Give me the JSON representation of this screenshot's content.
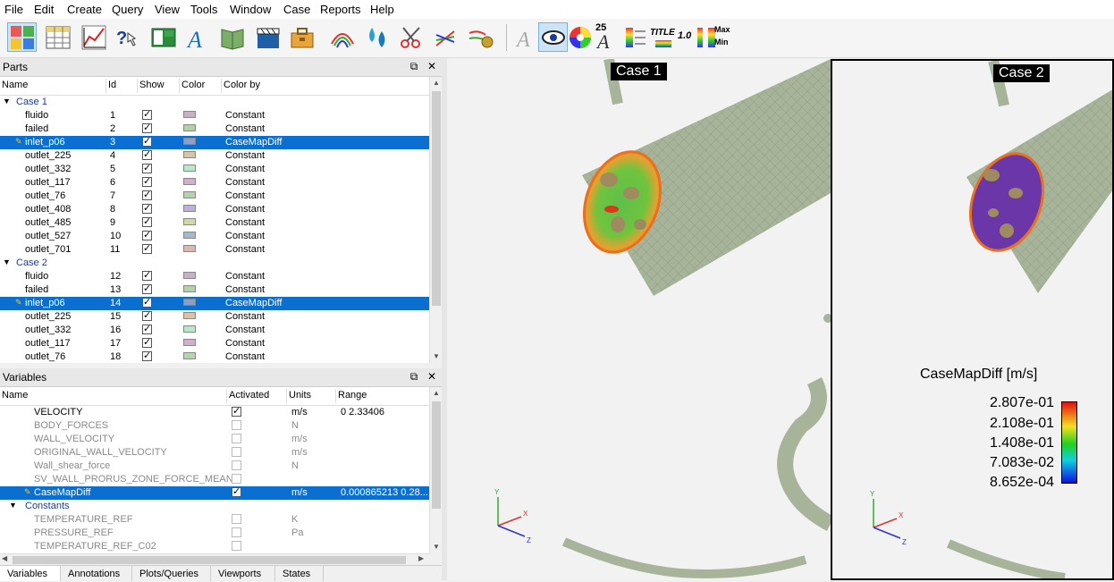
{
  "menu": [
    "File",
    "Edit",
    "Create",
    "Query",
    "View",
    "Tools",
    "Window",
    "Case",
    "Reports",
    "Help"
  ],
  "toolbar": {
    "icons": [
      "parts-icon",
      "table-icon",
      "chart-icon",
      "query-icon",
      "viewport-icon",
      "text-annotation-icon",
      "book-icon",
      "clapper-icon",
      "toolbox-icon",
      "contour-icon",
      "drops-icon",
      "scissors-icon",
      "vector-arrows-icon",
      "particle-trace-icon",
      "annotation-text-icon",
      "eye-icon",
      "color-wheel-icon",
      "font-size-icon",
      "palette-icon",
      "title-icon",
      "palette-rows-icon",
      "number-format-icon",
      "minmax-icon"
    ],
    "font_size_label": "25",
    "title_label": "TITLE",
    "number_label": "1.0",
    "max_label": "Max",
    "min_label": "Min"
  },
  "parts_panel": {
    "title": "Parts",
    "columns": [
      "Name",
      "Id",
      "Show",
      "Color",
      "Color by"
    ],
    "rows": [
      {
        "type": "group",
        "name": "Case 1"
      },
      {
        "name": "fluido",
        "id": "1",
        "show": true,
        "color": "#c9b0c9",
        "colorby": "Constant"
      },
      {
        "name": "failed",
        "id": "2",
        "show": true,
        "color": "#b5cfa8",
        "colorby": "Constant"
      },
      {
        "name": "inlet_p06",
        "id": "3",
        "show": true,
        "color": "#8aa0c8",
        "colorby": "CaseMapDiff",
        "selected": true
      },
      {
        "name": "outlet_225",
        "id": "4",
        "show": true,
        "color": "#d6c4a8",
        "colorby": "Constant"
      },
      {
        "name": "outlet_332",
        "id": "5",
        "show": true,
        "color": "#b8e8c8",
        "colorby": "Constant"
      },
      {
        "name": "outlet_117",
        "id": "6",
        "show": true,
        "color": "#d0b0c8",
        "colorby": "Constant"
      },
      {
        "name": "outlet_76",
        "id": "7",
        "show": true,
        "color": "#b4d4b0",
        "colorby": "Constant"
      },
      {
        "name": "outlet_408",
        "id": "8",
        "show": true,
        "color": "#c0b0d8",
        "colorby": "Constant"
      },
      {
        "name": "outlet_485",
        "id": "9",
        "show": true,
        "color": "#cfd8a8",
        "colorby": "Constant"
      },
      {
        "name": "outlet_527",
        "id": "10",
        "show": true,
        "color": "#a8b8c8",
        "colorby": "Constant"
      },
      {
        "name": "outlet_701",
        "id": "11",
        "show": true,
        "color": "#d8b8b0",
        "colorby": "Constant"
      },
      {
        "type": "group",
        "name": "Case 2"
      },
      {
        "name": "fluido",
        "id": "12",
        "show": true,
        "color": "#c9b0c9",
        "colorby": "Constant"
      },
      {
        "name": "failed",
        "id": "13",
        "show": true,
        "color": "#b5cfa8",
        "colorby": "Constant"
      },
      {
        "name": "inlet_p06",
        "id": "14",
        "show": true,
        "color": "#8aa0c8",
        "colorby": "CaseMapDiff",
        "selected": true
      },
      {
        "name": "outlet_225",
        "id": "15",
        "show": true,
        "color": "#d6c4a8",
        "colorby": "Constant"
      },
      {
        "name": "outlet_332",
        "id": "16",
        "show": true,
        "color": "#b8e8c8",
        "colorby": "Constant"
      },
      {
        "name": "outlet_117",
        "id": "17",
        "show": true,
        "color": "#d0b0c8",
        "colorby": "Constant"
      },
      {
        "name": "outlet_76",
        "id": "18",
        "show": true,
        "color": "#b4d4b0",
        "colorby": "Constant"
      }
    ]
  },
  "variables_panel": {
    "title": "Variables",
    "columns": [
      "Name",
      "Activated",
      "Units",
      "Range"
    ],
    "rows": [
      {
        "name": "VELOCITY",
        "activated": true,
        "units": "m/s",
        "range": "0  2.33406",
        "active": true
      },
      {
        "name": "BODY_FORCES",
        "activated": false,
        "units": "N",
        "range": ""
      },
      {
        "name": "WALL_VELOCITY",
        "activated": false,
        "units": "m/s",
        "range": ""
      },
      {
        "name": "ORIGINAL_WALL_VELOCITY",
        "activated": false,
        "units": "m/s",
        "range": ""
      },
      {
        "name": "Wall_shear_force",
        "activated": false,
        "units": "N",
        "range": ""
      },
      {
        "name": "SV_WALL_PRORUS_ZONE_FORCE_MEAN",
        "activated": false,
        "units": "",
        "range": ""
      },
      {
        "name": "CaseMapDiff",
        "activated": true,
        "units": "m/s",
        "range": "0.000865213  0.28...",
        "selected": true,
        "active": true
      },
      {
        "name": "Constants",
        "type": "group"
      },
      {
        "name": "TEMPERATURE_REF",
        "activated": false,
        "units": "K",
        "range": ""
      },
      {
        "name": "PRESSURE_REF",
        "activated": false,
        "units": "Pa",
        "range": ""
      },
      {
        "name": "TEMPERATURE_REF_C02",
        "activated": false,
        "units": "",
        "range": ""
      }
    ]
  },
  "bottom_tabs": [
    "Variables",
    "Annotations",
    "Plots/Queries",
    "Viewports",
    "States"
  ],
  "viewports": {
    "case1_label": "Case 1",
    "case2_label": "Case 2",
    "axis_x": "X",
    "axis_y": "Y",
    "axis_z": "Z"
  },
  "legend": {
    "title": "CaseMapDiff [m/s]",
    "values": [
      "2.807e-01",
      "2.108e-01",
      "1.408e-01",
      "7.083e-02",
      "8.652e-04"
    ]
  },
  "colors": {
    "selection": "#0a6fd1",
    "mesh": "#a8b49a",
    "mesh_dark": "#8f9b82",
    "group_text": "#1a3a9e"
  }
}
